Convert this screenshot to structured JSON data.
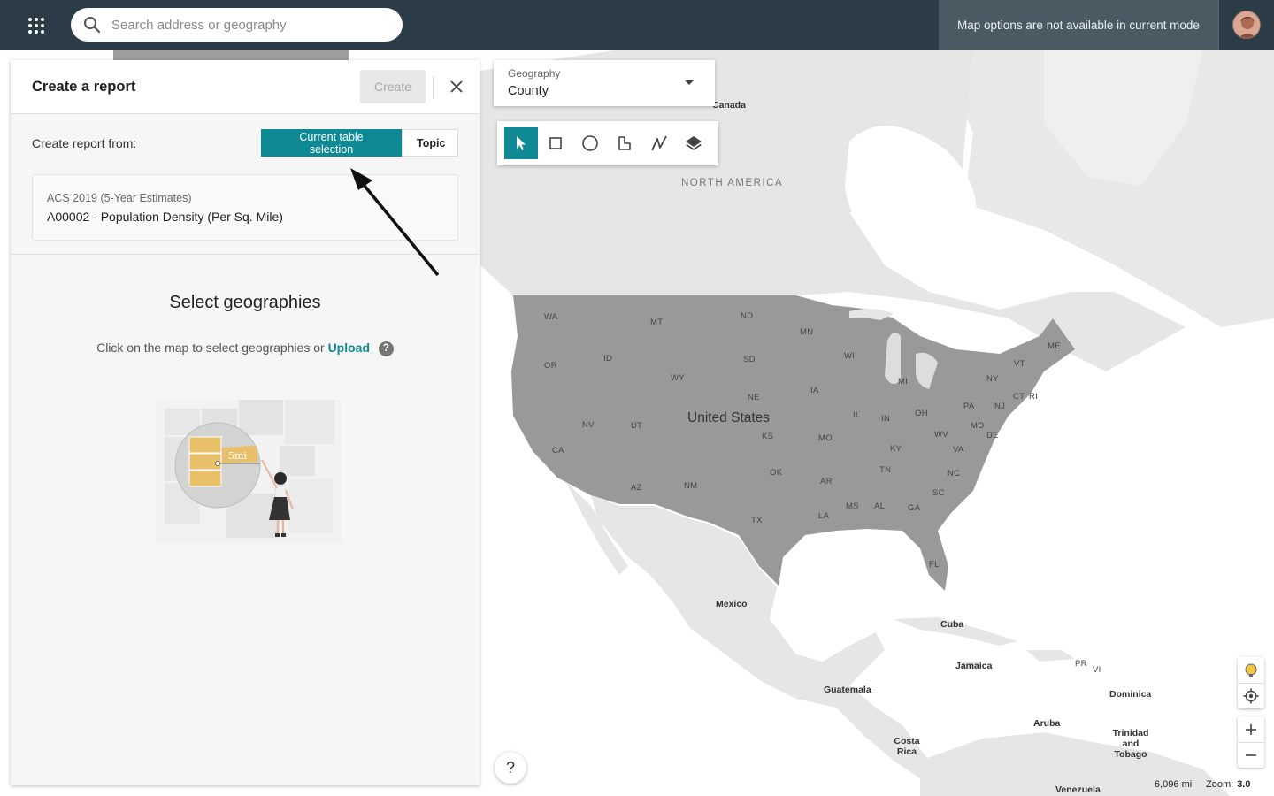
{
  "topbar": {
    "apps_icon": "apps-grid-icon",
    "search_placeholder": "Search address or geography",
    "map_notice": "Map options are not available in current mode",
    "avatar_icon": "user-avatar"
  },
  "report_panel": {
    "title": "Create a report",
    "create_label": "Create",
    "close_icon": "close-icon",
    "from_label": "Create report from:",
    "segments": [
      {
        "label": "Current table selection",
        "active": true
      },
      {
        "label": "Topic",
        "active": false
      }
    ],
    "table_source": "ACS 2019 (5-Year Estimates)",
    "table_name": "A00002 - Population Density (Per Sq. Mile)",
    "select_title": "Select geographies",
    "select_hint": "Click on the map to select geographies or",
    "upload_label": "Upload",
    "help_icon": "?",
    "illustration_label": "5mi"
  },
  "geography_dropdown": {
    "label": "Geography",
    "value": "County"
  },
  "tools": [
    "pointer-icon",
    "rectangle-icon",
    "circle-icon",
    "polygon-icon",
    "line-icon",
    "layers-icon"
  ],
  "map": {
    "region_label": "NORTH AMERICA",
    "country_main": "United States",
    "countries": [
      "Canada",
      "Mexico",
      "Cuba",
      "Jamaica",
      "Guatemala",
      "Costa Rica",
      "Aruba",
      "Dominica",
      "Trinidad and Tobago",
      "Venezuela",
      "PR",
      "VI"
    ],
    "states": [
      "WA",
      "MT",
      "ND",
      "MN",
      "OR",
      "ID",
      "SD",
      "WY",
      "WI",
      "MI",
      "VT",
      "ME",
      "NE",
      "IA",
      "NY",
      "NV",
      "UT",
      "IL",
      "IN",
      "OH",
      "PA",
      "NJ",
      "CT",
      "RI",
      "CA",
      "KS",
      "MO",
      "KY",
      "WV",
      "MD",
      "DE",
      "VA",
      "OK",
      "TN",
      "NC",
      "AZ",
      "NM",
      "AR",
      "SC",
      "MS",
      "AL",
      "GA",
      "TX",
      "LA",
      "FL"
    ],
    "colors": {
      "us_fill": "#999999",
      "land": "#e6e6e6",
      "water": "#ffffff",
      "accent": "#0f8a95"
    }
  },
  "footer": {
    "scale": "6,096 mi",
    "zoom_label": "Zoom:",
    "zoom_value": "3.0",
    "help_label": "?"
  },
  "controls": [
    "lightbulb-icon",
    "locate-icon",
    "zoom-in",
    "zoom-out"
  ]
}
